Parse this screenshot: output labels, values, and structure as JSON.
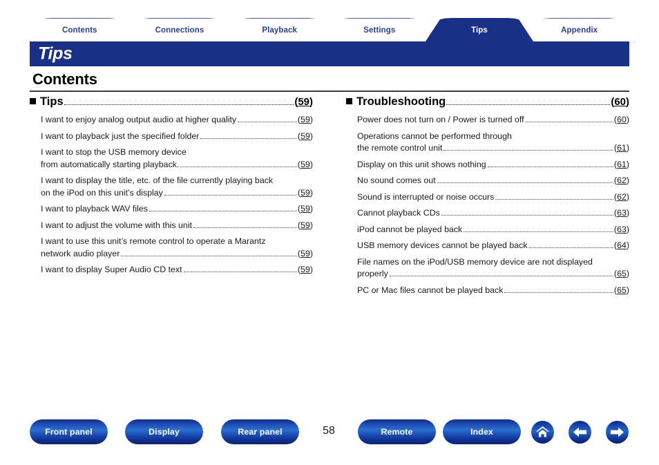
{
  "tabs": [
    {
      "label": "Contents",
      "active": false
    },
    {
      "label": "Connections",
      "active": false
    },
    {
      "label": "Playback",
      "active": false
    },
    {
      "label": "Settings",
      "active": false
    },
    {
      "label": "Tips",
      "active": true
    },
    {
      "label": "Appendix",
      "active": false
    }
  ],
  "title": "Tips",
  "section_heading": "Contents",
  "left_column": {
    "group": {
      "label": "Tips",
      "page": "59"
    },
    "entries": [
      {
        "line1": "",
        "text": "I want to enjoy analog output audio at higher quality",
        "page": "59"
      },
      {
        "line1": "",
        "text": "I want to playback just the specified folder",
        "page": "59"
      },
      {
        "line1": "I want to stop the USB memory device",
        "text": "from automatically starting playback. ",
        "page": "59"
      },
      {
        "line1": "I want to display the title, etc. of the file currently playing back",
        "text": "on the iPod on this unit’s display",
        "page": "59"
      },
      {
        "line1": "",
        "text": "I want to playback WAV files",
        "page": "59"
      },
      {
        "line1": "",
        "text": "I want to adjust the volume with this unit",
        "page": "59"
      },
      {
        "line1": "I want to use this unit’s remote control to operate a Marantz",
        "text": "network audio player ",
        "page": "59"
      },
      {
        "line1": "",
        "text": "I want to display Super Audio CD text ",
        "page": "59"
      }
    ]
  },
  "right_column": {
    "group": {
      "label": "Troubleshooting ",
      "page": "60"
    },
    "entries": [
      {
        "line1": "",
        "text": "Power does not turn on / Power is turned off ",
        "page": "60"
      },
      {
        "line1": "Operations cannot be performed through",
        "text": "the remote control unit",
        "page": "61"
      },
      {
        "line1": "",
        "text": "Display on this unit shows nothing ",
        "page": "61"
      },
      {
        "line1": "",
        "text": "No sound comes out ",
        "page": "62"
      },
      {
        "line1": "",
        "text": "Sound is interrupted or noise occurs",
        "page": "62"
      },
      {
        "line1": "",
        "text": "Cannot playback CDs ",
        "page": "63"
      },
      {
        "line1": "",
        "text": "iPod cannot be played back",
        "page": "63"
      },
      {
        "line1": "",
        "text": "USB memory devices cannot be played back ",
        "page": "64"
      },
      {
        "line1": "File names on the iPod/USB memory device are not displayed",
        "text": "properly ",
        "page": "65"
      },
      {
        "line1": "",
        "text": "PC or Mac files cannot be played back",
        "page": "65"
      }
    ]
  },
  "footer": {
    "buttons": [
      {
        "label": "Front panel"
      },
      {
        "label": "Display"
      },
      {
        "label": "Rear panel"
      },
      {
        "label": "Remote"
      },
      {
        "label": "Index"
      }
    ],
    "page_number": "58",
    "icons": [
      {
        "name": "home-icon"
      },
      {
        "name": "arrow-left-icon"
      },
      {
        "name": "arrow-right-icon"
      }
    ]
  },
  "colors": {
    "brand_navy": "#1a3087",
    "tab_border": "#4a58a0",
    "tab_text": "#2b3f90",
    "divider": "#3b3b3b"
  }
}
